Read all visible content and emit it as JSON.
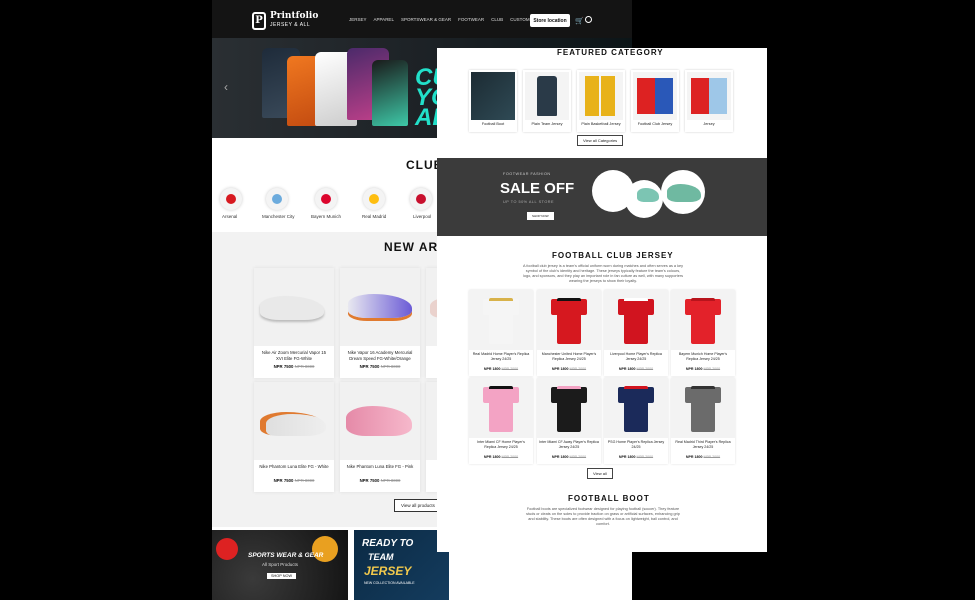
{
  "brand": {
    "name": "Printfolio",
    "tagline": "JERSEY & ALL"
  },
  "nav": {
    "items": [
      "Jersey",
      "Apparel",
      "Sportswear & Gear",
      "Footwear",
      "Club",
      "Custom"
    ],
    "store_button": "Store location"
  },
  "hero": {
    "text": "CU YO AL"
  },
  "clubs": {
    "title": "CLUBS",
    "items": [
      {
        "name": "Arsenal",
        "color": "#d71920"
      },
      {
        "name": "Manchester City",
        "color": "#6cabdd"
      },
      {
        "name": "Bayern Munich",
        "color": "#dc052d"
      },
      {
        "name": "Real Madrid",
        "color": "#febe10"
      },
      {
        "name": "Liverpool",
        "color": "#c8102e"
      }
    ]
  },
  "new_arrivals": {
    "title": "NEW ARRI",
    "products": [
      {
        "name": "Nike Air Zoom Mercurial Vapor 15 XVI Elite FG-White",
        "price": "NPR 7500",
        "old": "NPR 8000"
      },
      {
        "name": "Nike Vapor 16 Academy Mercurial Dream Speed FG-White/Orange",
        "price": "NPR 7500",
        "old": "NPR 8000"
      },
      {
        "name": "Nike Phantom Luna Elite FG - White",
        "price": "NPR 7500",
        "old": "NPR 8000"
      },
      {
        "name": "Nike Phantom Luna Elite FG - Pink",
        "price": "NPR 7500",
        "old": "NPR 8000"
      }
    ],
    "view_all": "View all products"
  },
  "promo": {
    "sports": {
      "title": "SPORTS WEAR & GEAR",
      "sub": "All Sport Products",
      "btn": "SHOP NOW"
    },
    "jersey": {
      "title": "READY TO",
      "title2": "TEAM",
      "title3": "JERSEY",
      "sub": "NEW COLLECTION AVAILABLE"
    }
  },
  "featured": {
    "title": "FEATURED CATEGORY",
    "items": [
      "Football Boot",
      "Plain Team Jersey",
      "Plain Basketball Jersey",
      "Football Club Jersey",
      "Jersey"
    ],
    "btn": "View all Categories"
  },
  "sale": {
    "eyebrow": "FOOTWEAR FASHION",
    "title": "SALE OFF",
    "sub": "UP TO 50% ALL STORE",
    "btn": "SHOP NOW"
  },
  "club_jersey": {
    "title": "FOOTBALL CLUB JERSEY",
    "desc": "A football club jersey is a team's official uniform worn during matches and often serves as a key symbol of the club's identity and heritage. These jerseys typically feature the team's colours, logo, and sponsors, and they play an important role in fan culture as well, with many supporters wearing the jerseys to show their loyalty.",
    "items": [
      {
        "name": "Real Madrid Home Player's Replica Jersey 24/25",
        "price": "NPR 1800",
        "old": "NPR 2000",
        "body": "#f5f5f5",
        "trim": "#d8b24a"
      },
      {
        "name": "Manchester United Home Player's Replica Jersey 24/25",
        "price": "NPR 1800",
        "old": "NPR 2000",
        "body": "#d6181f",
        "trim": "#111"
      },
      {
        "name": "Liverpool Home Player's Replica Jersey 24/25",
        "price": "NPR 1800",
        "old": "NPR 2000",
        "body": "#d1141f",
        "trim": "#fff"
      },
      {
        "name": "Bayern Munich Home Player's Replica Jersey 24/25",
        "price": "NPR 1800",
        "old": "NPR 2000",
        "body": "#e3222a",
        "trim": "#b8141c"
      },
      {
        "name": "Inter Miami CF Home Player's Replica Jersey 24/25",
        "price": "NPR 1800",
        "old": "NPR 2000",
        "body": "#f3a3c4",
        "trim": "#111"
      },
      {
        "name": "Inter Miami CF Away Player's Replica Jersey 24/25",
        "price": "NPR 1800",
        "old": "NPR 2000",
        "body": "#1b1b1b",
        "trim": "#f3a3c4"
      },
      {
        "name": "PSG Home Player's Replica Jersey 24/25",
        "price": "NPR 1800",
        "old": "NPR 2000",
        "body": "#1b2a5a",
        "trim": "#d1141f"
      },
      {
        "name": "Real Madrid Third Player's Replica Jersey 24/25",
        "price": "NPR 1800",
        "old": "NPR 2000",
        "body": "#6b6b6b",
        "trim": "#333"
      }
    ],
    "btn": "View all"
  },
  "boots": {
    "title": "FOOTBALL BOOT",
    "desc": "Football boots are specialized footwear designed for playing football (soccer). They feature studs or cleats on the soles to provide traction on grass or artificial surfaces, enhancing grip and stability. These boots are often designed with a focus on lightweight, ball control, and comfort."
  }
}
